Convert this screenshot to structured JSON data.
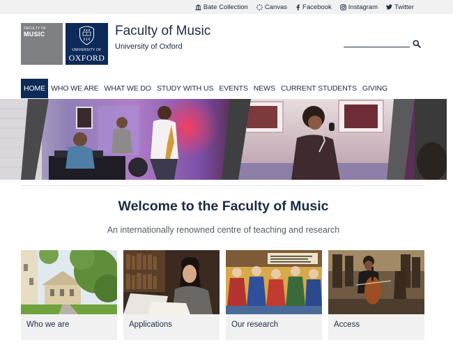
{
  "utility_links": [
    {
      "label": "Bate Collection",
      "icon": "institution-icon"
    },
    {
      "label": "Canvas",
      "icon": "canvas-icon"
    },
    {
      "label": "Facebook",
      "icon": "facebook-icon"
    },
    {
      "label": "Instagram",
      "icon": "instagram-icon"
    },
    {
      "label": "Twitter",
      "icon": "twitter-icon"
    }
  ],
  "header": {
    "faculty_logo_small": "FACULTY OF",
    "faculty_logo_big": "MUSIC",
    "oxford_logo_small": "UNIVERSITY OF",
    "oxford_logo_big": "OXFORD",
    "title": "Faculty of Music",
    "subtitle": "University of Oxford",
    "search_placeholder": "",
    "search_icon": "search-icon"
  },
  "nav": [
    {
      "label": "HOME",
      "active": true
    },
    {
      "label": "WHO WE ARE"
    },
    {
      "label": "WHAT WE DO"
    },
    {
      "label": "STUDY WITH US"
    },
    {
      "label": "EVENTS"
    },
    {
      "label": "NEWS"
    },
    {
      "label": "CURRENT STUDENTS"
    },
    {
      "label": "GIVING"
    }
  ],
  "welcome": {
    "title": "Welcome to the Faculty of Music",
    "subtitle": "An internationally renowned centre of teaching and research"
  },
  "cards": [
    {
      "label": "Who we are"
    },
    {
      "label": "Applications"
    },
    {
      "label": "Our research"
    },
    {
      "label": "Access"
    }
  ],
  "colors": {
    "navy": "#0d2a58",
    "text": "#1b2a44",
    "grey_logo": "#7e8083",
    "card_bg": "#f1f1f1"
  }
}
